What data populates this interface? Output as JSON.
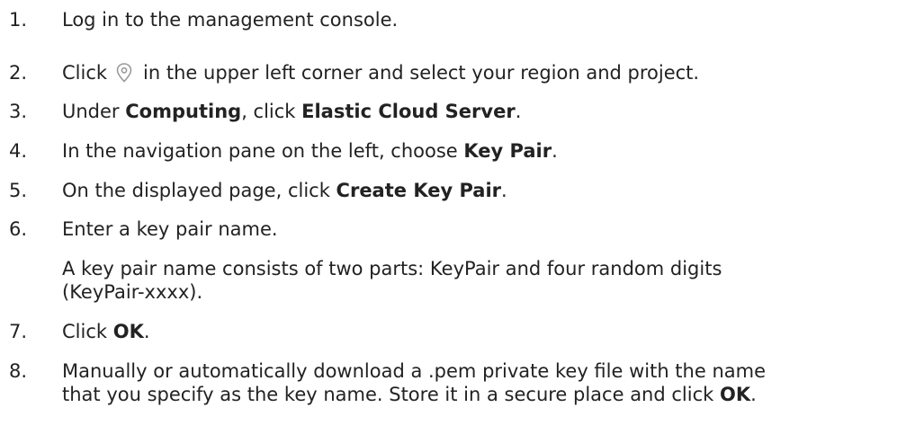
{
  "steps": [
    {
      "num": "1.",
      "text": "Log in to the management console."
    },
    {
      "num": "2.",
      "pre": "Click",
      "icon": "location-pin-icon",
      "post": "in the upper left corner and select your region and project."
    },
    {
      "num": "3.",
      "pre": "Under ",
      "bold1": "Computing",
      "mid": ", click ",
      "bold2": "Elastic Cloud Server",
      "post": "."
    },
    {
      "num": "4.",
      "pre": "In the navigation pane on the left, choose ",
      "bold": "Key Pair",
      "post": "."
    },
    {
      "num": "5.",
      "pre": "On the displayed page, click ",
      "bold": "Create Key Pair",
      "post": "."
    },
    {
      "num": "6.",
      "text": "Enter a key pair name.",
      "note_line1": "A key pair name consists of two parts: KeyPair and four random digits",
      "note_line2": "(KeyPair-xxxx)."
    },
    {
      "num": "7.",
      "pre": "Click ",
      "bold": "OK",
      "post": "."
    },
    {
      "num": "8.",
      "line1": "Manually or automatically download a .pem private key file with the name",
      "line2_pre": "that you specify as the key name. Store it in a secure place and click ",
      "bold": "OK",
      "post": "."
    }
  ],
  "colors": {
    "text": "#222222",
    "icon": "#9a9a9a"
  }
}
